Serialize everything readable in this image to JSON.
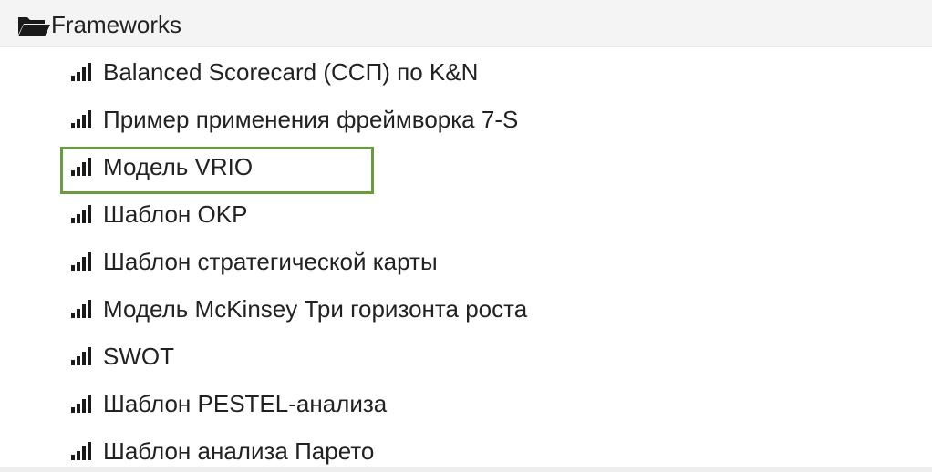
{
  "folder": {
    "label": "Frameworks",
    "icon": "open-folder-icon"
  },
  "items": [
    {
      "label": "Balanced Scorecard (ССП) по K&N",
      "icon": "signal-bars-icon"
    },
    {
      "label": "Пример применения фреймворка 7-S",
      "icon": "signal-bars-icon"
    },
    {
      "label": "Модель VRIO",
      "icon": "signal-bars-icon",
      "selected": true
    },
    {
      "label": "Шаблон OKP",
      "icon": "signal-bars-icon"
    },
    {
      "label": "Шаблон стратегической карты",
      "icon": "signal-bars-icon"
    },
    {
      "label": "Модель McKinsey Три горизонта роста",
      "icon": "signal-bars-icon"
    },
    {
      "label": "SWOT",
      "icon": "signal-bars-icon"
    },
    {
      "label": "Шаблон PESTEL-анализа",
      "icon": "signal-bars-icon"
    },
    {
      "label": "Шаблон анализа Парето",
      "icon": "signal-bars-icon"
    }
  ],
  "colors": {
    "selection_border": "#6a9b3e",
    "header_background": "#f4f4f4",
    "text": "#222222"
  }
}
